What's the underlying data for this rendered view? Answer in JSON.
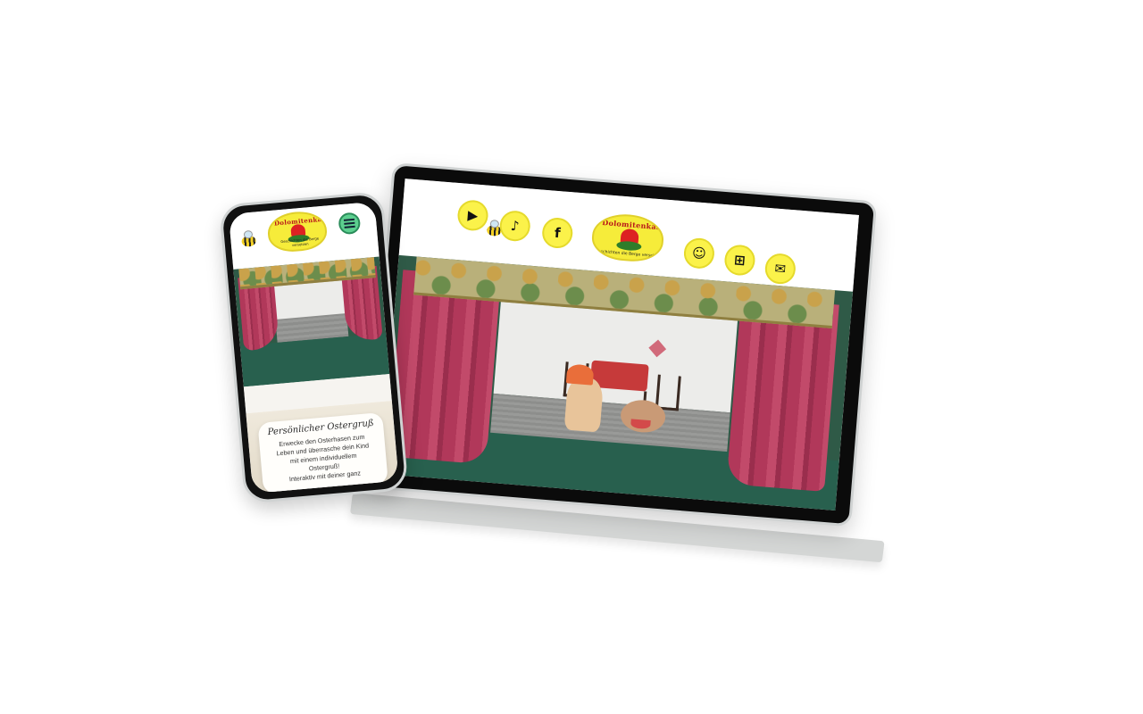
{
  "laptop": {
    "social": {
      "youtube_icon": "youtube-icon",
      "tiktok_icon": "tiktok-icon",
      "facebook_icon": "facebook-icon"
    },
    "logo": {
      "name": "Dolomitenkasperl",
      "tagline": "Geschichten die Berge versetzen"
    },
    "actions": {
      "account_icon": "user-icon",
      "cart_icon": "basket-icon",
      "mail_icon": "mail-icon"
    }
  },
  "phone": {
    "logo": {
      "name": "Dolomitenkasperl",
      "tagline": "Geschichten die Berge versetzen"
    },
    "menu_icon": "hamburger-menu-icon",
    "card": {
      "title": "Persönlicher Ostergruß",
      "text": "Erwecke den Osterhasen zum\nLeben und überrasche dein Kind\nmit einem individuellem\nOstergruß!\nInteraktiv mit deiner ganz"
    }
  },
  "colors": {
    "accent_yellow": "#fbf24a",
    "curtain_red": "#b1385a",
    "stage_green": "#2f5a47",
    "menu_green": "#5ccf8f"
  }
}
